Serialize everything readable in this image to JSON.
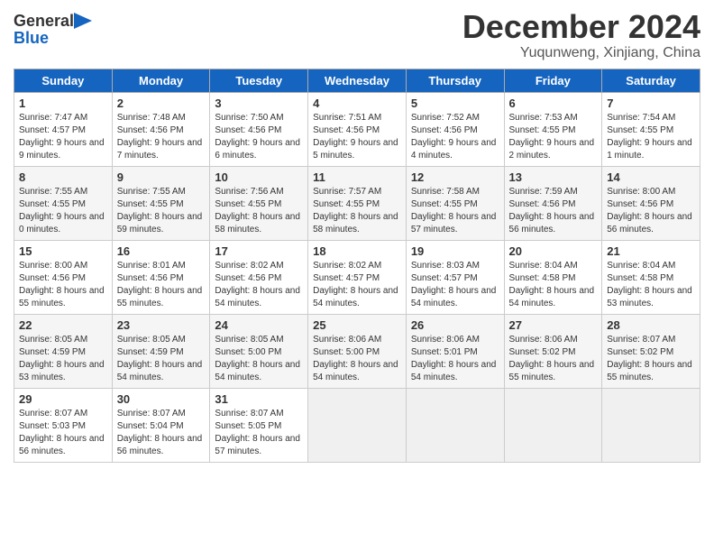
{
  "header": {
    "logo_line1": "General",
    "logo_line2": "Blue",
    "month": "December 2024",
    "location": "Yuqunweng, Xinjiang, China"
  },
  "days_of_week": [
    "Sunday",
    "Monday",
    "Tuesday",
    "Wednesday",
    "Thursday",
    "Friday",
    "Saturday"
  ],
  "weeks": [
    [
      {
        "day": "1",
        "sunrise": "7:47 AM",
        "sunset": "4:57 PM",
        "daylight": "9 hours and 9 minutes."
      },
      {
        "day": "2",
        "sunrise": "7:48 AM",
        "sunset": "4:56 PM",
        "daylight": "9 hours and 7 minutes."
      },
      {
        "day": "3",
        "sunrise": "7:50 AM",
        "sunset": "4:56 PM",
        "daylight": "9 hours and 6 minutes."
      },
      {
        "day": "4",
        "sunrise": "7:51 AM",
        "sunset": "4:56 PM",
        "daylight": "9 hours and 5 minutes."
      },
      {
        "day": "5",
        "sunrise": "7:52 AM",
        "sunset": "4:56 PM",
        "daylight": "9 hours and 4 minutes."
      },
      {
        "day": "6",
        "sunrise": "7:53 AM",
        "sunset": "4:55 PM",
        "daylight": "9 hours and 2 minutes."
      },
      {
        "day": "7",
        "sunrise": "7:54 AM",
        "sunset": "4:55 PM",
        "daylight": "9 hours and 1 minute."
      }
    ],
    [
      {
        "day": "8",
        "sunrise": "7:55 AM",
        "sunset": "4:55 PM",
        "daylight": "9 hours and 0 minutes."
      },
      {
        "day": "9",
        "sunrise": "7:55 AM",
        "sunset": "4:55 PM",
        "daylight": "8 hours and 59 minutes."
      },
      {
        "day": "10",
        "sunrise": "7:56 AM",
        "sunset": "4:55 PM",
        "daylight": "8 hours and 58 minutes."
      },
      {
        "day": "11",
        "sunrise": "7:57 AM",
        "sunset": "4:55 PM",
        "daylight": "8 hours and 58 minutes."
      },
      {
        "day": "12",
        "sunrise": "7:58 AM",
        "sunset": "4:55 PM",
        "daylight": "8 hours and 57 minutes."
      },
      {
        "day": "13",
        "sunrise": "7:59 AM",
        "sunset": "4:56 PM",
        "daylight": "8 hours and 56 minutes."
      },
      {
        "day": "14",
        "sunrise": "8:00 AM",
        "sunset": "4:56 PM",
        "daylight": "8 hours and 56 minutes."
      }
    ],
    [
      {
        "day": "15",
        "sunrise": "8:00 AM",
        "sunset": "4:56 PM",
        "daylight": "8 hours and 55 minutes."
      },
      {
        "day": "16",
        "sunrise": "8:01 AM",
        "sunset": "4:56 PM",
        "daylight": "8 hours and 55 minutes."
      },
      {
        "day": "17",
        "sunrise": "8:02 AM",
        "sunset": "4:56 PM",
        "daylight": "8 hours and 54 minutes."
      },
      {
        "day": "18",
        "sunrise": "8:02 AM",
        "sunset": "4:57 PM",
        "daylight": "8 hours and 54 minutes."
      },
      {
        "day": "19",
        "sunrise": "8:03 AM",
        "sunset": "4:57 PM",
        "daylight": "8 hours and 54 minutes."
      },
      {
        "day": "20",
        "sunrise": "8:04 AM",
        "sunset": "4:58 PM",
        "daylight": "8 hours and 54 minutes."
      },
      {
        "day": "21",
        "sunrise": "8:04 AM",
        "sunset": "4:58 PM",
        "daylight": "8 hours and 53 minutes."
      }
    ],
    [
      {
        "day": "22",
        "sunrise": "8:05 AM",
        "sunset": "4:59 PM",
        "daylight": "8 hours and 53 minutes."
      },
      {
        "day": "23",
        "sunrise": "8:05 AM",
        "sunset": "4:59 PM",
        "daylight": "8 hours and 54 minutes."
      },
      {
        "day": "24",
        "sunrise": "8:05 AM",
        "sunset": "5:00 PM",
        "daylight": "8 hours and 54 minutes."
      },
      {
        "day": "25",
        "sunrise": "8:06 AM",
        "sunset": "5:00 PM",
        "daylight": "8 hours and 54 minutes."
      },
      {
        "day": "26",
        "sunrise": "8:06 AM",
        "sunset": "5:01 PM",
        "daylight": "8 hours and 54 minutes."
      },
      {
        "day": "27",
        "sunrise": "8:06 AM",
        "sunset": "5:02 PM",
        "daylight": "8 hours and 55 minutes."
      },
      {
        "day": "28",
        "sunrise": "8:07 AM",
        "sunset": "5:02 PM",
        "daylight": "8 hours and 55 minutes."
      }
    ],
    [
      {
        "day": "29",
        "sunrise": "8:07 AM",
        "sunset": "5:03 PM",
        "daylight": "8 hours and 56 minutes."
      },
      {
        "day": "30",
        "sunrise": "8:07 AM",
        "sunset": "5:04 PM",
        "daylight": "8 hours and 56 minutes."
      },
      {
        "day": "31",
        "sunrise": "8:07 AM",
        "sunset": "5:05 PM",
        "daylight": "8 hours and 57 minutes."
      },
      null,
      null,
      null,
      null
    ]
  ]
}
